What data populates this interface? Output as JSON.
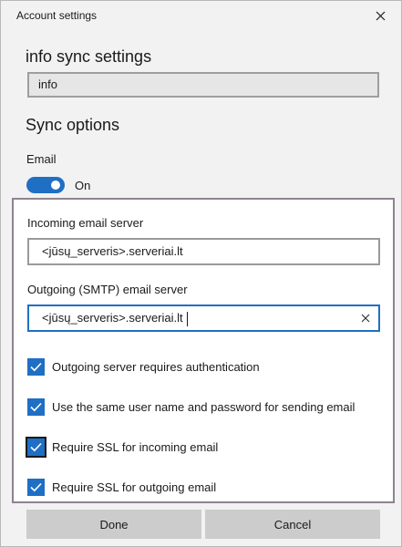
{
  "window": {
    "title": "Account settings"
  },
  "account": {
    "heading": "info sync settings",
    "name_value": "info"
  },
  "sync": {
    "heading": "Sync options",
    "email_label": "Email",
    "toggle_state": "On"
  },
  "servers": {
    "incoming_label": "Incoming email server",
    "incoming_value": "<jūsų_serveris>.serveriai.lt",
    "outgoing_label": "Outgoing (SMTP) email server",
    "outgoing_value": "<jūsų_serveris>.serveriai.lt"
  },
  "options": [
    {
      "label": "Outgoing server requires authentication",
      "checked": true
    },
    {
      "label": "Use the same user name and password for sending email",
      "checked": true
    },
    {
      "label": "Require SSL for incoming email",
      "checked": true
    },
    {
      "label": "Require SSL for outgoing email",
      "checked": true
    }
  ],
  "buttons": {
    "done": "Done",
    "cancel": "Cancel"
  },
  "colors": {
    "accent": "#1f6fc5",
    "panel_border": "#8f8290",
    "button_bg": "#cccccc"
  },
  "icons": {
    "close": "close-icon",
    "clear": "clear-icon",
    "check": "checkmark-icon"
  }
}
